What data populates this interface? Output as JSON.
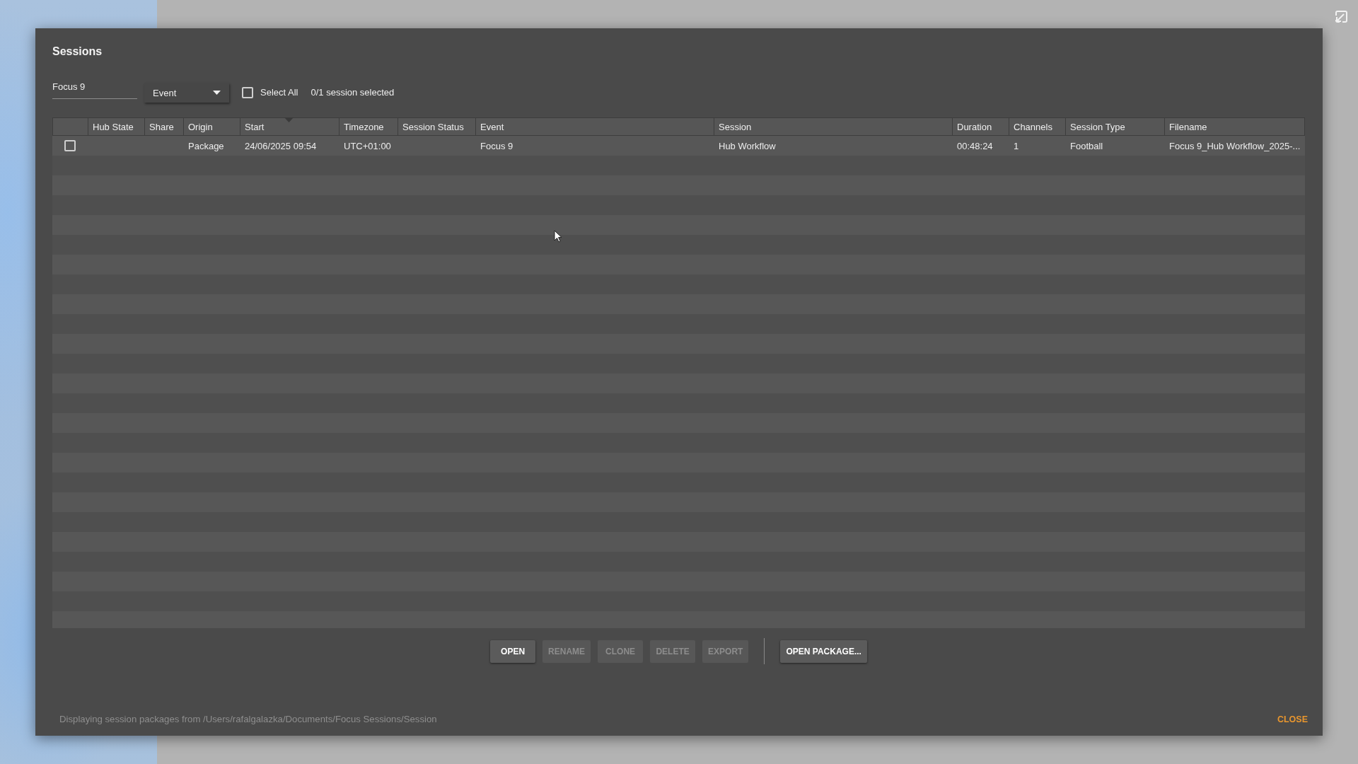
{
  "dialog": {
    "title": "Sessions",
    "filters": {
      "search": {
        "value": "Focus 9"
      },
      "group_by": {
        "value": "Event"
      },
      "select_all": {
        "label": "Select All",
        "checked": false
      },
      "selection_count": "0/1 session selected"
    },
    "table": {
      "columns": [
        {
          "label": "Hub State",
          "sorted": false
        },
        {
          "label": "Share",
          "sorted": false
        },
        {
          "label": "Origin",
          "sorted": false
        },
        {
          "label": "Start",
          "sorted": true
        },
        {
          "label": "Timezone",
          "sorted": false
        },
        {
          "label": "Session Status",
          "sorted": false
        },
        {
          "label": "Event",
          "sorted": false
        },
        {
          "label": "Session",
          "sorted": false
        },
        {
          "label": "Duration",
          "sorted": false
        },
        {
          "label": "Channels",
          "sorted": false
        },
        {
          "label": "Session Type",
          "sorted": false
        },
        {
          "label": "Filename",
          "sorted": false
        }
      ],
      "rows": [
        {
          "checked": false,
          "cells": [
            null,
            null,
            "Package",
            "24/06/2025 09:54",
            "UTC+01:00",
            null,
            "Focus 9",
            "Hub Workflow",
            "00:48:24",
            "1",
            "Football",
            "Focus 9_Hub Workflow_2025-..."
          ]
        }
      ]
    },
    "button_groups": [
      {
        "buttons": [
          {
            "label": "OPEN",
            "disabled": false
          },
          {
            "label": "RENAME",
            "disabled": true
          },
          {
            "label": "CLONE",
            "disabled": true
          },
          {
            "label": "DELETE",
            "disabled": true
          },
          {
            "label": "EXPORT",
            "disabled": true
          }
        ]
      },
      {
        "buttons": [
          {
            "label": "OPEN PACKAGE...",
            "disabled": false
          }
        ]
      }
    ],
    "status_text": "Displaying session packages from /Users/rafalgalazka/Documents/Focus Sessions/Session",
    "close_button": {
      "label": "CLOSE"
    }
  }
}
